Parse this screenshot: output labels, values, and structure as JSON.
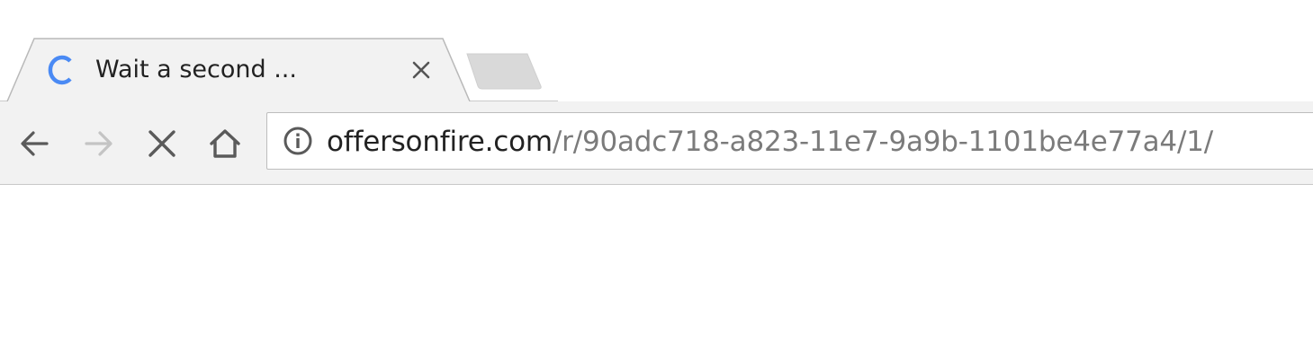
{
  "tab": {
    "title": "Wait a second ...",
    "loading_icon": "loading-spinner-icon",
    "close_icon": "close-icon"
  },
  "new_tab": {
    "icon": "new-tab-icon"
  },
  "toolbar": {
    "back_icon": "arrow-left-icon",
    "forward_icon": "arrow-right-icon",
    "stop_icon": "close-icon",
    "home_icon": "home-icon",
    "forward_enabled": false
  },
  "omnibox": {
    "security_icon": "info-circle-icon",
    "url_domain": "offersonfire.com",
    "url_path": "/r/90adc718-a823-11e7-9a9b-1101be4e77a4/1/"
  },
  "colors": {
    "spinner": "#4a8af4",
    "toolbar_bg": "#f2f2f2",
    "icon": "#5a5a5a",
    "icon_disabled": "#c4c4c4",
    "url_domain": "#222222",
    "url_path": "#7b7b7b"
  }
}
